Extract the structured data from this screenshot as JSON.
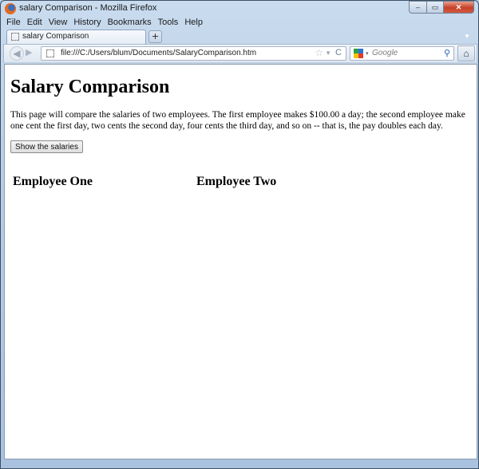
{
  "window": {
    "title": "salary Comparison - Mozilla Firefox",
    "controls": {
      "minimize": "–",
      "maximize": "▭",
      "close": "✕"
    }
  },
  "menubar": {
    "items": [
      {
        "label": "File",
        "accel": "F"
      },
      {
        "label": "Edit",
        "accel": "E"
      },
      {
        "label": "View",
        "accel": "V"
      },
      {
        "label": "History",
        "accel": "s"
      },
      {
        "label": "Bookmarks",
        "accel": "B"
      },
      {
        "label": "Tools",
        "accel": "T"
      },
      {
        "label": "Help",
        "accel": "H"
      }
    ]
  },
  "tabs": {
    "active": {
      "label": "salary Comparison"
    },
    "new_tab_label": "+",
    "list_all_icon": "▼"
  },
  "navbar": {
    "back_icon": "◀",
    "forward_icon": "▶",
    "url": "file:///C:/Users/blum/Documents/SalaryComparison.htm",
    "bookmark_icon": "☆",
    "dropdown_icon": "▼",
    "reload_icon": "C",
    "search": {
      "engine": "Google",
      "placeholder": "Google",
      "dropdown_icon": "▾",
      "search_icon": "⚲"
    },
    "home_icon": "⌂"
  },
  "page": {
    "heading": "Salary Comparison",
    "description": "This page will compare the salaries of two employees. The first employee makes $100.00 a day; the second employee make one cent the first day, two cents the second day, four cents the third day, and so on -- that is, the pay doubles each day.",
    "button_label": "Show the salaries",
    "employee_one": "Employee One",
    "employee_two": "Employee Two"
  }
}
